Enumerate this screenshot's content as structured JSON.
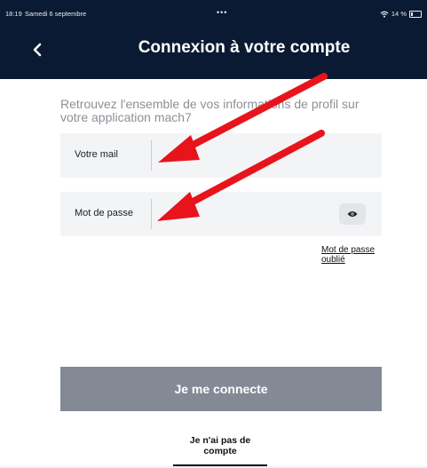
{
  "statusbar": {
    "time": "18:19",
    "date": "Samedi 6 septembre",
    "dots": "•••",
    "battery": "14 %"
  },
  "header": {
    "title": "Connexion à votre compte",
    "back_icon": "chevron-left-icon"
  },
  "intro_text": "Retrouvez l'ensemble de vos informations de profil sur votre application mach7",
  "email_field": {
    "label": "Votre mail",
    "value": ""
  },
  "password_field": {
    "label": "Mot de passe",
    "value": "",
    "toggle_icon": "eye-icon"
  },
  "forgot_password": "Mot de passe oublié",
  "login_button": "Je me connecte",
  "no_account_link": "Je n'ai pas de compte",
  "colors": {
    "header_bg": "#0b1a33",
    "button_bg": "#838a95",
    "field_bg": "#f3f4f6",
    "annotation_arrow": "#e8141b"
  }
}
